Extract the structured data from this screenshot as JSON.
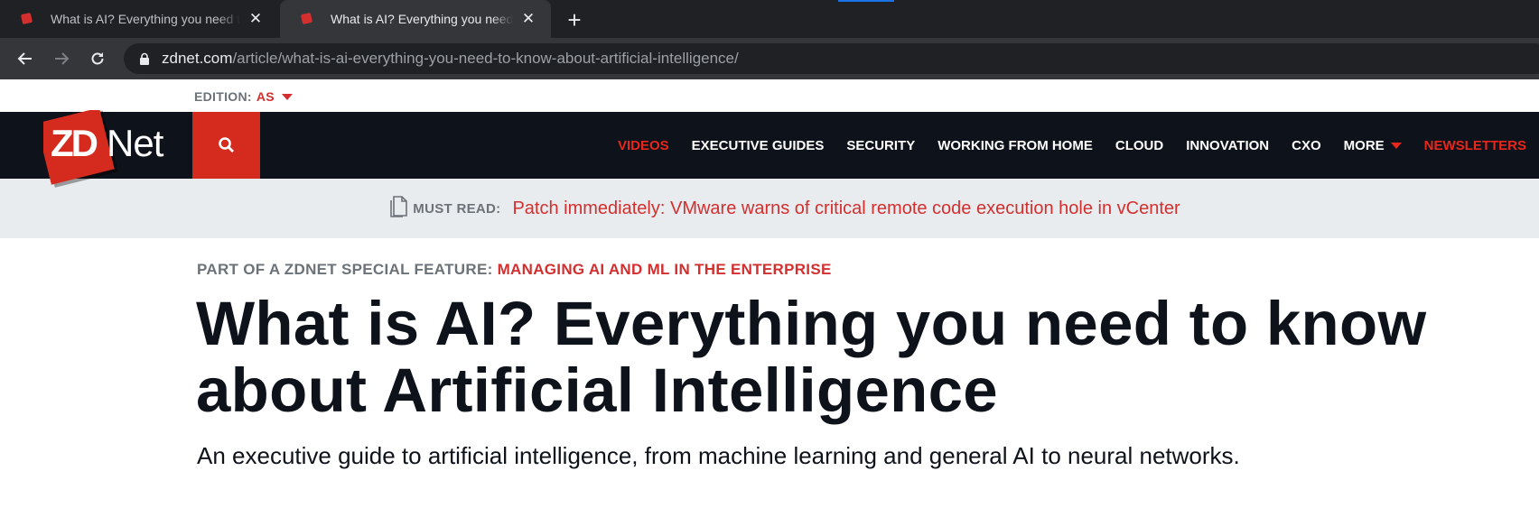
{
  "browser": {
    "tabs": [
      {
        "title": "What is AI? Everything you need to know about Artificial Intelligence",
        "active": false
      },
      {
        "title": "What is AI? Everything you need to know about Artificial Intelligence",
        "active": true
      }
    ],
    "url_host": "zdnet.com",
    "url_path": "/article/what-is-ai-everything-you-need-to-know-about-artificial-intelligence/",
    "colors": {
      "chrome": "#202124",
      "toolbar": "#35363a"
    }
  },
  "edition": {
    "label": "EDITION:",
    "value": "AS"
  },
  "logo": {
    "text_zd": "ZD",
    "text_net": "Net"
  },
  "nav": {
    "items": [
      {
        "label": "VIDEOS",
        "accent": true
      },
      {
        "label": "EXECUTIVE GUIDES"
      },
      {
        "label": "SECURITY"
      },
      {
        "label": "WORKING FROM HOME"
      },
      {
        "label": "CLOUD"
      },
      {
        "label": "INNOVATION"
      },
      {
        "label": "CXO"
      },
      {
        "label": "MORE"
      },
      {
        "label": "NEWSLETTERS",
        "accent": true
      }
    ],
    "colors": {
      "bar": "#0e121a",
      "accent": "#e8261a",
      "search": "#d52b1e"
    }
  },
  "must_read": {
    "label": "MUST READ:",
    "link": "Patch immediately: VMware warns of critical remote code execution hole in vCenter"
  },
  "article": {
    "feature_prefix": "PART OF A ZDNET SPECIAL FEATURE:",
    "feature_name": "MANAGING AI AND ML IN THE ENTERPRISE",
    "headline": "What is AI? Everything you need to know about Artificial Intelligence",
    "dek": "An executive guide to artificial intelligence, from machine learning and general AI to neural networks."
  }
}
